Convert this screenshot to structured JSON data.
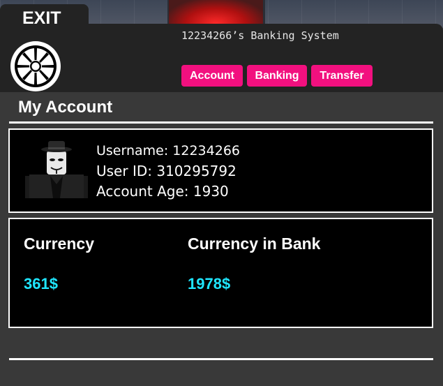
{
  "window": {
    "exit_label": "EXIT",
    "title": "12234266’s Banking System"
  },
  "tabs": [
    {
      "label": "Account"
    },
    {
      "label": "Banking"
    },
    {
      "label": "Transfer"
    }
  ],
  "section": {
    "title": "My Account"
  },
  "account": {
    "username": "Username: 12234266",
    "user_id": "User ID: 310295792",
    "account_age": "Account Age: 1930"
  },
  "currency": {
    "wallet_label": "Currency",
    "wallet_value": "361$",
    "bank_label": "Currency in Bank",
    "bank_value": "1978$"
  },
  "colors": {
    "tab_bg": "#f2107f",
    "currency_value": "#1fe6ff",
    "panel_bg": "#232323",
    "content_bg": "#393939"
  },
  "icons": {
    "logo": "galactic-republic-emblem-icon"
  }
}
